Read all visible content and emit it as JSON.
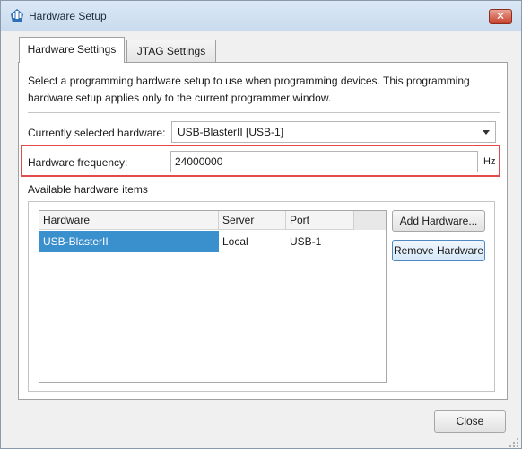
{
  "window": {
    "title": "Hardware Setup",
    "close_glyph": "✕",
    "icon": "quartus-app-icon"
  },
  "tabs": [
    {
      "label": "Hardware Settings",
      "active": true
    },
    {
      "label": "JTAG Settings",
      "active": false
    }
  ],
  "settings": {
    "description": "Select a programming hardware setup to use when programming devices. This programming hardware setup applies only to the current programmer window.",
    "current_hardware_label": "Currently selected hardware:",
    "current_hardware_value": "USB-BlasterII [USB-1]",
    "frequency_label": "Hardware frequency:",
    "frequency_value": "24000000",
    "frequency_unit": "Hz",
    "available_label": "Available hardware items"
  },
  "table": {
    "columns": [
      "Hardware",
      "Server",
      "Port"
    ],
    "rows": [
      {
        "hardware": "USB-BlasterII",
        "server": "Local",
        "port": "USB-1",
        "selected": true
      }
    ]
  },
  "buttons": {
    "add": "Add Hardware...",
    "remove": "Remove Hardware",
    "close": "Close"
  },
  "colors": {
    "highlight_border": "#e24b4b",
    "selection": "#3a8fcd"
  }
}
